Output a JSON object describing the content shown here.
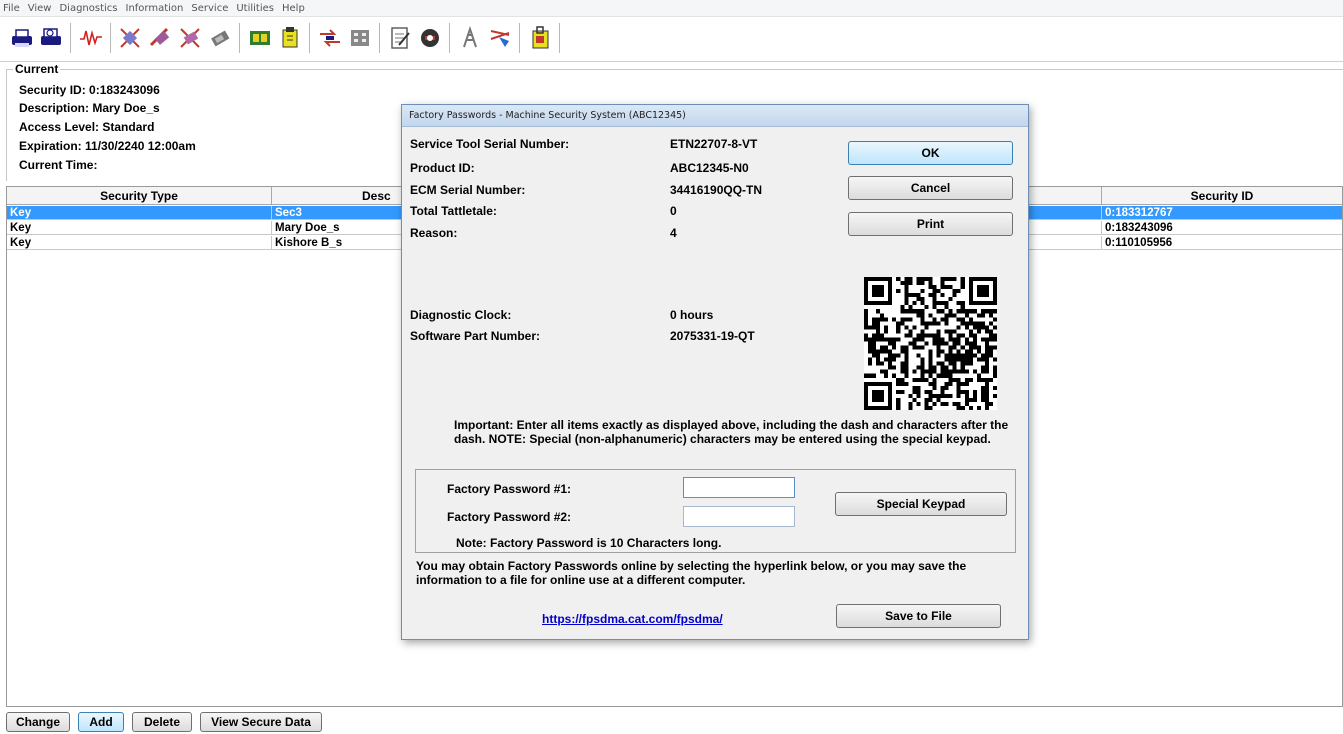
{
  "menu": [
    "File",
    "View",
    "Diagnostics",
    "Information",
    "Service",
    "Utilities",
    "Help"
  ],
  "toolbar": {
    "icons": [
      "print-icon",
      "print-preview-icon",
      "waveform-icon",
      "security-icon-1",
      "security-icon-2",
      "security-icon-3",
      "security-icon-4",
      "ecm-icon",
      "flash-icon",
      "swap-icon",
      "keypad-icon",
      "document-icon",
      "security-shield-icon",
      "tower-icon",
      "filter-icon",
      "lock-card-icon"
    ]
  },
  "current": {
    "title": "Current",
    "security_id": "Security ID: 0:183243096",
    "description": "Description: Mary Doe_s",
    "access_level": "Access Level: Standard",
    "expiration": "Expiration: 11/30/2240 12:00am",
    "current_time": "Current Time:"
  },
  "table": {
    "headers": {
      "security_type": "Security Type",
      "description": "Desc",
      "security_id": "Security ID"
    },
    "rows": [
      {
        "type": "Key",
        "description": "Sec3",
        "security_id": "0:183312767"
      },
      {
        "type": "Key",
        "description": "Mary Doe_s",
        "security_id": "0:183243096"
      },
      {
        "type": "Key",
        "description": "Kishore B_s",
        "security_id": "0:110105956"
      }
    ]
  },
  "buttons": {
    "change": "Change",
    "add": "Add",
    "delete": "Delete",
    "view_secure_data": "View Secure Data"
  },
  "dialog": {
    "title": "Factory Passwords - Machine Security System (ABC12345)",
    "fields": [
      {
        "label": "Service Tool Serial Number:",
        "value": "ETN22707-8-VT"
      },
      {
        "label": "Product ID:",
        "value": "ABC12345-N0"
      },
      {
        "label": "ECM Serial Number:",
        "value": "34416190QQ-TN"
      },
      {
        "label": "Total Tattletale:",
        "value": "0"
      },
      {
        "label": "Reason:",
        "value": "4"
      },
      {
        "label": "Diagnostic Clock:",
        "value": "0 hours"
      },
      {
        "label": "Software Part Number:",
        "value": "2075331-19-QT"
      }
    ],
    "ok": "OK",
    "cancel": "Cancel",
    "print": "Print",
    "important": "Important: Enter all items exactly as displayed above, including the dash and characters after the dash.  NOTE: Special (non-alphanumeric) characters may be entered using the special keypad.",
    "password1_label": "Factory Password #1:",
    "password2_label": "Factory Password #2:",
    "password1_value": "",
    "password2_value": "",
    "note": "Note: Factory Password is 10 Characters long.",
    "special_keypad": "Special Keypad",
    "obtain_text": "You may obtain Factory Passwords online by selecting the hyperlink below, or you may save the information to a file for online use at a different computer.",
    "link": "https://fpsdma.cat.com/fpsdma/",
    "save_to_file": "Save to File"
  }
}
